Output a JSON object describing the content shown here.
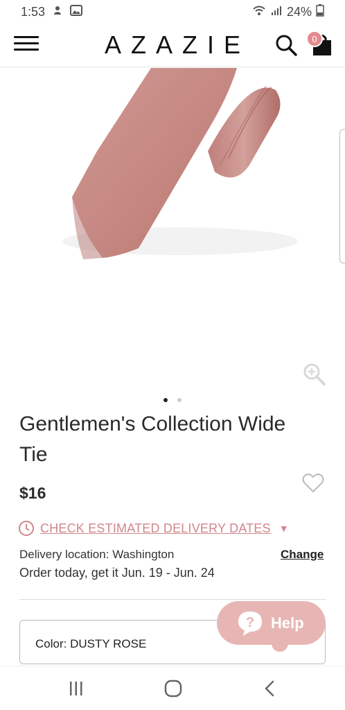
{
  "status_bar": {
    "time": "1:53",
    "battery": "24%"
  },
  "header": {
    "brand": "AZAZIE",
    "cart_count": "0"
  },
  "product": {
    "title": "Gentlemen's Collection Wide Tie",
    "price": "$16",
    "image_color": "#c68a86",
    "gallery": {
      "total": 2,
      "active": 1
    }
  },
  "delivery": {
    "link_label": "CHECK ESTIMATED DELIVERY DATES",
    "location_label": "Delivery location:",
    "location_value": "Washington",
    "change_label": "Change",
    "order_text": "Order today, get it Jun. 19 - Jun. 24"
  },
  "color_select": {
    "label": "Color: DUSTY ROSE"
  },
  "help": {
    "label": "Help"
  },
  "colors": {
    "accent": "#d1868b",
    "help_bg": "#e7b6b4"
  }
}
